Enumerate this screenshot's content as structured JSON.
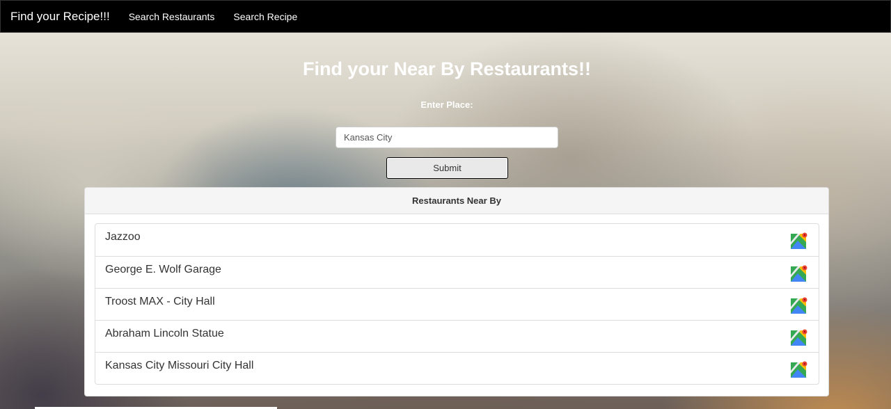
{
  "navbar": {
    "brand": "Find your Recipe!!!",
    "links": [
      "Search Restaurants",
      "Search Recipe"
    ]
  },
  "main": {
    "heading": "Find your Near By Restaurants!!",
    "place_label": "Enter Place:",
    "place_value": "Kansas City",
    "submit_label": "Submit"
  },
  "results": {
    "heading": "Restaurants Near By",
    "items": [
      {
        "name": "Jazzoo",
        "icon": "google-maps-icon"
      },
      {
        "name": "George E. Wolf Garage",
        "icon": "google-maps-icon"
      },
      {
        "name": "Troost MAX - City Hall",
        "icon": "google-maps-icon"
      },
      {
        "name": "Abraham Lincoln Statue",
        "icon": "google-maps-icon"
      },
      {
        "name": "Kansas City Missouri City Hall",
        "icon": "google-maps-icon"
      }
    ]
  }
}
